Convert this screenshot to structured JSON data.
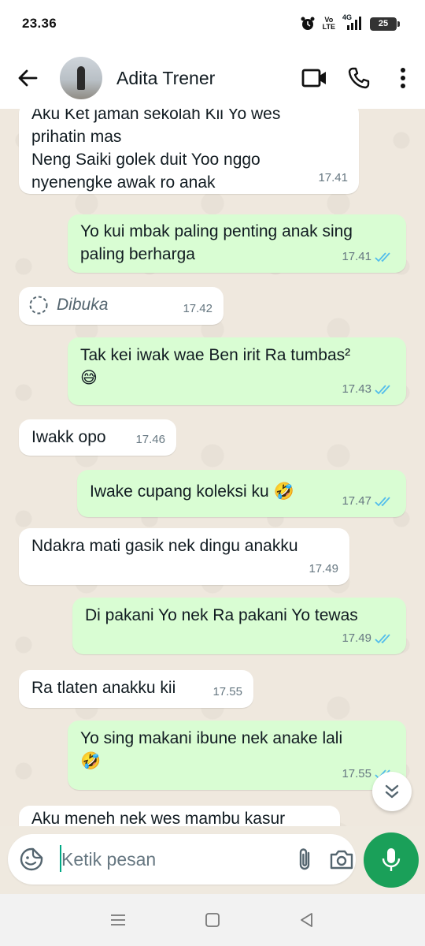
{
  "status_bar": {
    "time": "23.36",
    "volte_top": "Vo",
    "volte_bottom": "LTE",
    "network": "4G",
    "battery": "25"
  },
  "header": {
    "contact_name": "Adita Trener"
  },
  "messages": [
    {
      "direction": "in",
      "lines": [
        "Aku Ket jaman sekolah Kii Yo wes",
        "prihatin mas",
        "Neng Saiki golek duit Yoo nggo",
        "nyenengke awak ro anak"
      ],
      "time": "17.41"
    },
    {
      "direction": "out",
      "lines": [
        "Yo kui mbak paling penting anak sing",
        "paling berharga"
      ],
      "time": "17.41",
      "status": "read"
    },
    {
      "direction": "in",
      "lines": [
        "Dibuka"
      ],
      "time": "17.42",
      "type": "view-once"
    },
    {
      "direction": "out",
      "lines": [
        "Tak kei iwak wae Ben irit Ra tumbas²",
        "😅"
      ],
      "time": "17.43",
      "status": "read"
    },
    {
      "direction": "in",
      "lines": [
        "Iwakk opo"
      ],
      "time": "17.46"
    },
    {
      "direction": "out",
      "lines": [
        "Iwake cupang koleksi ku 🤣"
      ],
      "time": "17.47",
      "status": "read"
    },
    {
      "direction": "in",
      "lines": [
        "Ndakra mati gasik nek dingu anakku"
      ],
      "time": "17.49"
    },
    {
      "direction": "out",
      "lines": [
        "Di pakani Yo nek Ra pakani Yo tewas"
      ],
      "time": "17.49",
      "status": "read"
    },
    {
      "direction": "in",
      "lines": [
        "Ra tlaten anakku kii"
      ],
      "time": "17.55"
    },
    {
      "direction": "out",
      "lines": [
        "Yo sing makani ibune nek anake lali",
        "🤣"
      ],
      "time": "17.55",
      "status": "read"
    },
    {
      "direction": "in",
      "lines": [
        "Aku meneh nek wes mambu kasur"
      ],
      "time": ""
    }
  ],
  "composer": {
    "placeholder": "Ketik pesan"
  },
  "colors": {
    "incoming": "#ffffff",
    "outgoing": "#d9fdd3",
    "tick_read": "#53bdeb",
    "accent": "#1aa059",
    "wallpaper": "#efe8de"
  },
  "icons": {
    "back": "arrow-left-icon",
    "video": "video-camera-icon",
    "call": "phone-icon",
    "menu": "more-vertical-icon",
    "emoji": "sticker-smile-icon",
    "attach": "paperclip-icon",
    "camera": "camera-icon",
    "mic": "microphone-icon",
    "scroll": "double-chevron-down-icon"
  }
}
